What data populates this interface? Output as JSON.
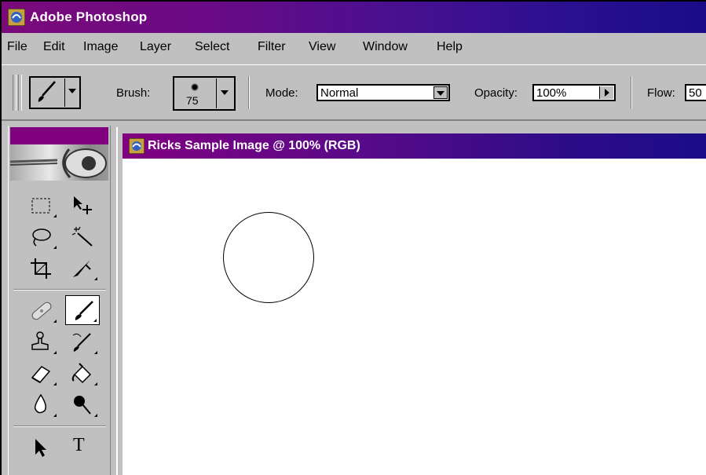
{
  "app": {
    "title": "Adobe Photoshop"
  },
  "menu": [
    "File",
    "Edit",
    "Image",
    "Layer",
    "Select",
    "Filter",
    "View",
    "Window",
    "Help"
  ],
  "options": {
    "brush_label": "Brush:",
    "brush_size": "75",
    "mode_label": "Mode:",
    "mode_value": "Normal",
    "opacity_label": "Opacity:",
    "opacity_value": "100%",
    "flow_label": "Flow:",
    "flow_value": "50"
  },
  "document": {
    "title": "Ricks Sample Image @ 100% (RGB)"
  },
  "colors": {
    "title_start": "#7a0a7a",
    "title_end": "#1a0c88",
    "toolbar_bg": "#c0c0c0"
  },
  "toolbox": {
    "tools": [
      "marquee-tool",
      "move-tool",
      "lasso-tool",
      "magic-wand-tool",
      "crop-tool",
      "slice-tool",
      "healing-brush-tool",
      "brush-tool",
      "clone-stamp-tool",
      "history-brush-tool",
      "eraser-tool",
      "paint-bucket-tool",
      "blur-tool",
      "dodge-tool",
      "path-selection-tool",
      "type-tool"
    ],
    "active": "brush-tool",
    "type_glyph": "T"
  }
}
